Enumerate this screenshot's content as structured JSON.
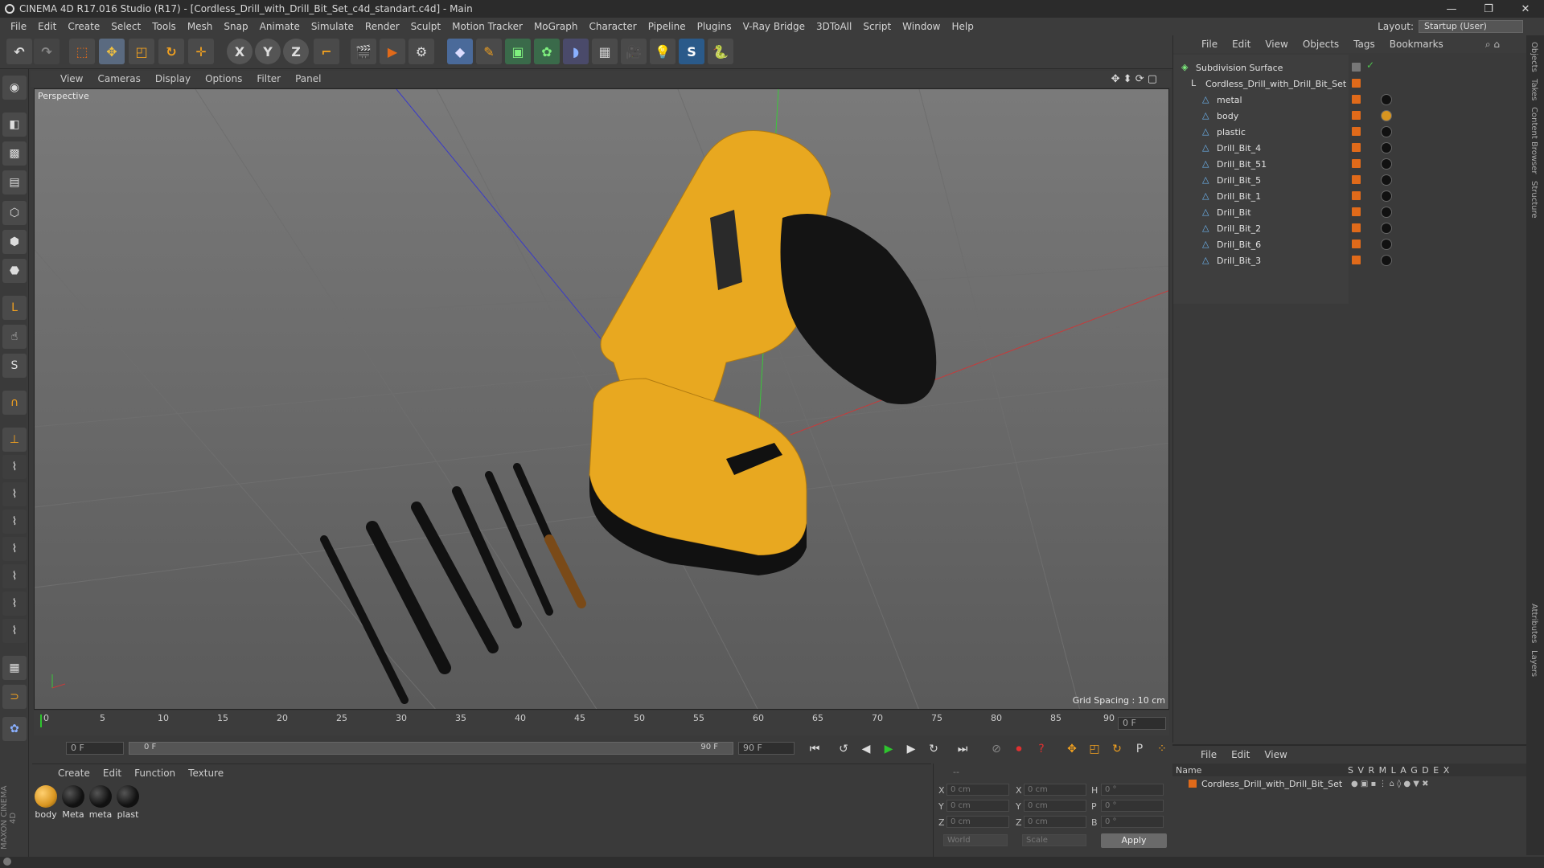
{
  "window": {
    "title": "CINEMA 4D R17.016 Studio (R17) - [Cordless_Drill_with_Drill_Bit_Set_c4d_standart.c4d] - Main"
  },
  "menu": [
    "File",
    "Edit",
    "Create",
    "Select",
    "Tools",
    "Mesh",
    "Snap",
    "Animate",
    "Simulate",
    "Render",
    "Sculpt",
    "Motion Tracker",
    "MoGraph",
    "Character",
    "Pipeline",
    "Plugins",
    "V-Ray Bridge",
    "3DToAll",
    "Script",
    "Window",
    "Help"
  ],
  "layout": {
    "label": "Layout:",
    "value": "Startup (User)"
  },
  "viewport": {
    "menu": [
      "View",
      "Cameras",
      "Display",
      "Options",
      "Filter",
      "Panel"
    ],
    "label": "Perspective",
    "grid_spacing": "Grid Spacing : 10 cm"
  },
  "timeline": {
    "ticks": [
      "0",
      "5",
      "10",
      "15",
      "20",
      "25",
      "30",
      "35",
      "40",
      "45",
      "50",
      "55",
      "60",
      "65",
      "70",
      "75",
      "80",
      "85",
      "90"
    ],
    "frame_readout": "0 F",
    "start_field": "0 F",
    "slider_start": "0 F",
    "slider_end": "90 F",
    "end_field": "90 F"
  },
  "materials": {
    "menu": [
      "Create",
      "Edit",
      "Function",
      "Texture"
    ],
    "items": [
      {
        "name": "body",
        "color": "#d89520"
      },
      {
        "name": "Meta",
        "color": "#111111"
      },
      {
        "name": "meta",
        "color": "#111111"
      },
      {
        "name": "plast",
        "color": "#111111"
      }
    ]
  },
  "coordinates": {
    "header": "--",
    "rows": [
      {
        "a": "X",
        "av": "0 cm",
        "b": "X",
        "bv": "0 cm",
        "c": "H",
        "cv": "0 °"
      },
      {
        "a": "Y",
        "av": "0 cm",
        "b": "Y",
        "bv": "0 cm",
        "c": "P",
        "cv": "0 °"
      },
      {
        "a": "Z",
        "av": "0 cm",
        "b": "Z",
        "bv": "0 cm",
        "c": "B",
        "cv": "0 °"
      }
    ],
    "space": "World",
    "mode": "Scale",
    "apply": "Apply"
  },
  "objects": {
    "menu": [
      "File",
      "Edit",
      "View",
      "Objects",
      "Tags",
      "Bookmarks"
    ],
    "items": [
      {
        "name": "Subdivision Surface"
      },
      {
        "name": "Cordless_Drill_with_Drill_Bit_Set"
      },
      {
        "name": "metal"
      },
      {
        "name": "body"
      },
      {
        "name": "plastic"
      },
      {
        "name": "Drill_Bit_4"
      },
      {
        "name": "Drill_Bit_51"
      },
      {
        "name": "Drill_Bit_5"
      },
      {
        "name": "Drill_Bit_1"
      },
      {
        "name": "Drill_Bit"
      },
      {
        "name": "Drill_Bit_2"
      },
      {
        "name": "Drill_Bit_6"
      },
      {
        "name": "Drill_Bit_3"
      }
    ]
  },
  "layers": {
    "menu": [
      "File",
      "Edit",
      "View"
    ],
    "header": {
      "name": "Name",
      "cols": "S  V  R  M  L  A  G  D  E  X"
    },
    "row": "Cordless_Drill_with_Drill_Bit_Set"
  },
  "sidetabs": [
    "Objects",
    "Takes",
    "Content Browser",
    "Structure",
    "Attributes",
    "Layers"
  ],
  "brand": "MAXON CINEMA 4D",
  "colors": {
    "accent": "#e06a1a",
    "viewport_bg": "#6a6a6a",
    "drill_yellow": "#e8a820"
  }
}
